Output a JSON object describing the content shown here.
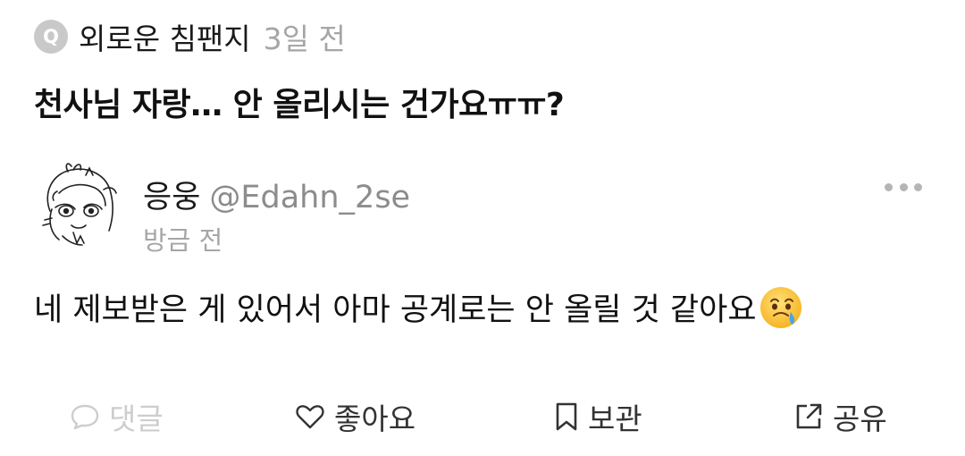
{
  "question": {
    "badge_letter": "Q",
    "asker": "외로운 침팬지",
    "time": "3일 전",
    "text": "천사님 자랑… 안 올리시는 건가요ㅠㅠ?"
  },
  "answer": {
    "author_name": "응웅",
    "author_handle": "@Edahn_2se",
    "time": "방금 전",
    "text": "네 제보받은 게 있어서 아마 공계로는 안 올릴 것 같아요",
    "emoji": "face-holding-back-tears-emoji"
  },
  "actions": {
    "comment": "댓글",
    "like": "좋아요",
    "save": "보관",
    "share": "공유"
  },
  "colors": {
    "muted": "#a6a6a6",
    "disabled": "#cdcdcd",
    "badge": "#c9c9c9"
  }
}
